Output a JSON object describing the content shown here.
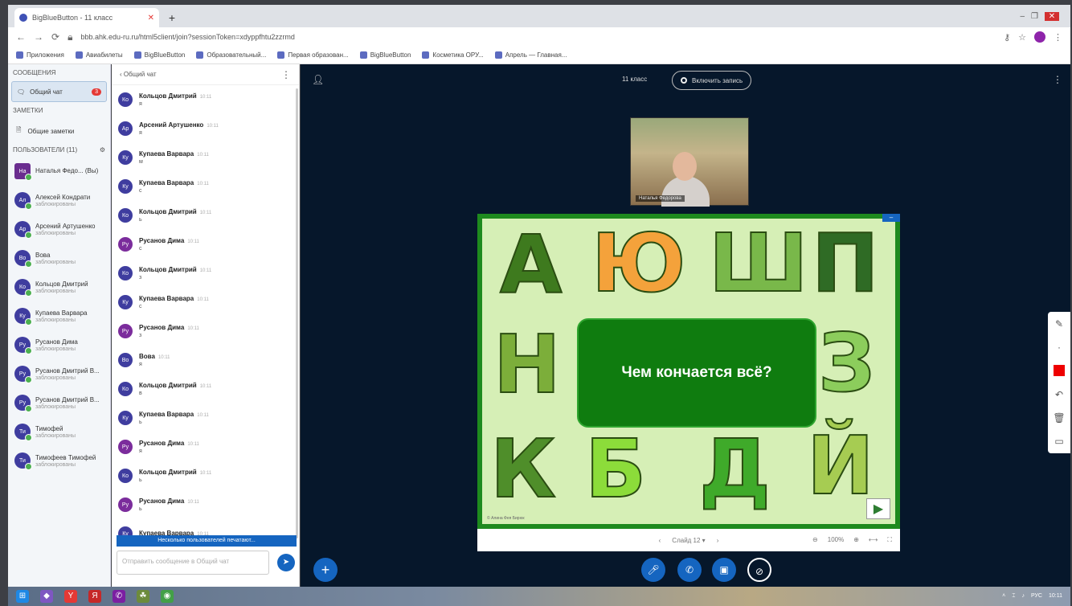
{
  "browser": {
    "tab_title": "BigBlueButton - 11 класс",
    "url": "bbb.ahk.edu-ru.ru/html5client/join?sessionToken=xdyppfhtu2zzrmd",
    "bookmarks": [
      "Приложения",
      "Авиабилеты",
      "BigBlueButton",
      "Образовательный...",
      "Первая образован...",
      "BigBlueButton",
      "Косметика ОРУ...",
      "Апрель — Главная..."
    ]
  },
  "sidebar": {
    "messages_header": "СООБЩЕНИЯ",
    "public_chat_label": "Общий чат",
    "unread_count": "3",
    "notes_header": "ЗАМЕТКИ",
    "shared_notes_label": "Общие заметки",
    "users_header": "ПОЛЬЗОВАТЕЛИ (11)",
    "users": [
      {
        "initials": "На",
        "name": "Наталья Федо... (Вы)",
        "role": "",
        "moderator": true
      },
      {
        "initials": "Ал",
        "name": "Алексей Кондрати",
        "role": "заблокированы",
        "moderator": false
      },
      {
        "initials": "Ар",
        "name": "Арсений Артушенко",
        "role": "заблокированы",
        "moderator": false
      },
      {
        "initials": "Во",
        "name": "Вова",
        "role": "заблокированы",
        "moderator": false
      },
      {
        "initials": "Ко",
        "name": "Кольцов Дмитрий",
        "role": "заблокированы",
        "moderator": false
      },
      {
        "initials": "Ку",
        "name": "Купаева Варвара",
        "role": "заблокированы",
        "moderator": false
      },
      {
        "initials": "Ру",
        "name": "Русанов Дима",
        "role": "заблокированы",
        "moderator": false
      },
      {
        "initials": "Ру",
        "name": "Русанов Дмитрий В...",
        "role": "заблокированы",
        "moderator": false
      },
      {
        "initials": "Ру",
        "name": "Русанов Дмитрий В...",
        "role": "заблокированы",
        "moderator": false
      },
      {
        "initials": "Ти",
        "name": "Тимофей",
        "role": "заблокированы",
        "moderator": false
      },
      {
        "initials": "Ти",
        "name": "Тимофеев Тимофей",
        "role": "заблокированы",
        "moderator": false
      }
    ]
  },
  "chat": {
    "title": "Общий чат",
    "messages": [
      {
        "initials": "Ко",
        "name": "Кольцов Дмитрий",
        "time": "10:11",
        "text": "я",
        "purple": false
      },
      {
        "initials": "Ар",
        "name": "Арсений Артушенко",
        "time": "10:11",
        "text": "я",
        "purple": false
      },
      {
        "initials": "Ку",
        "name": "Купаева Варвара",
        "time": "10:11",
        "text": "м",
        "purple": false
      },
      {
        "initials": "Ку",
        "name": "Купаева Варвара",
        "time": "10:11",
        "text": "с",
        "purple": false
      },
      {
        "initials": "Ко",
        "name": "Кольцов Дмитрий",
        "time": "10:11",
        "text": "ь",
        "purple": false
      },
      {
        "initials": "Ру",
        "name": "Русанов Дима",
        "time": "10:11",
        "text": "с",
        "purple": true
      },
      {
        "initials": "Ко",
        "name": "Кольцов Дмитрий",
        "time": "10:11",
        "text": "з",
        "purple": false
      },
      {
        "initials": "Ку",
        "name": "Купаева Варвара",
        "time": "10:11",
        "text": "с",
        "purple": false
      },
      {
        "initials": "Ру",
        "name": "Русанов Дима",
        "time": "10:11",
        "text": "з",
        "purple": true
      },
      {
        "initials": "Во",
        "name": "Вова",
        "time": "10:11",
        "text": "я",
        "purple": false
      },
      {
        "initials": "Ко",
        "name": "Кольцов Дмитрий",
        "time": "10:11",
        "text": "в",
        "purple": false
      },
      {
        "initials": "Ку",
        "name": "Купаева Варвара",
        "time": "10:11",
        "text": "ь",
        "purple": false
      },
      {
        "initials": "Ру",
        "name": "Русанов Дима",
        "time": "10:11",
        "text": "я",
        "purple": true
      },
      {
        "initials": "Ко",
        "name": "Кольцов Дмитрий",
        "time": "10:11",
        "text": "ь",
        "purple": false
      },
      {
        "initials": "Ру",
        "name": "Русанов Дима",
        "time": "10:11",
        "text": "ь",
        "purple": true
      },
      {
        "initials": "Ку",
        "name": "Купаева Варвара",
        "time": "10:11",
        "text": "",
        "purple": false
      }
    ],
    "typing_label": "Несколько пользователей печатают...",
    "input_placeholder": "Отправить сообщение в Общий чат"
  },
  "main": {
    "meeting_title": "11 класс",
    "record_label": "Включить запись",
    "webcam_name": "Наталья Федорова",
    "slide": {
      "question": "Чем кончается всё?",
      "letters": [
        "А",
        "Ю",
        "Ш",
        "П",
        "Н",
        "З",
        "К",
        "Б",
        "Д",
        "Й"
      ],
      "credit": "© Алина Фея Бирюк",
      "page_label": "Слайд 12",
      "zoom": "100%"
    }
  },
  "taskbar": {
    "time": "10:11",
    "lang": "РУС"
  }
}
